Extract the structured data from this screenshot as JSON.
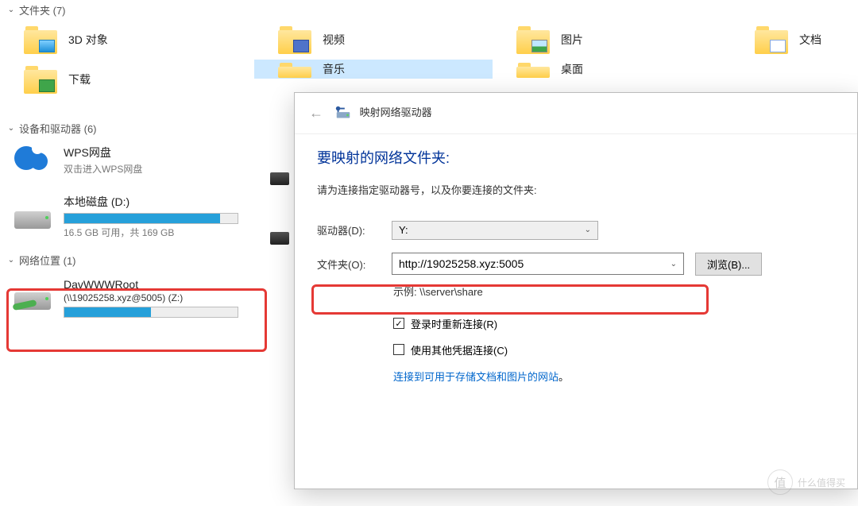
{
  "sections": {
    "folders_header": "文件夹 (7)",
    "devices_header": "设备和驱动器 (6)",
    "network_header": "网络位置 (1)"
  },
  "folders": {
    "f3d": "3D 对象",
    "videos": "视频",
    "pictures": "图片",
    "documents": "文档",
    "downloads": "下载",
    "music": "音乐",
    "desktop": "桌面"
  },
  "wps": {
    "title": "WPS网盘",
    "sub": "双击进入WPS网盘"
  },
  "local_disk": {
    "title": "本地磁盘 (D:)",
    "usage_text": "16.5 GB 可用，共 169 GB",
    "fill_pct": 90
  },
  "network_drive": {
    "title": "DavWWWRoot",
    "sub": "(\\\\19025258.xyz@5005) (Z:)",
    "fill_pct": 50
  },
  "dialog": {
    "title": "映射网络驱动器",
    "heading": "要映射的网络文件夹:",
    "desc": "请为连接指定驱动器号，以及你要连接的文件夹:",
    "drive_label": "驱动器(D):",
    "drive_value": "Y:",
    "folder_label": "文件夹(O):",
    "folder_value": "http://19025258.xyz:5005",
    "browse": "浏览(B)...",
    "example": "示例: \\\\server\\share",
    "reconnect": "登录时重新连接(R)",
    "othercred": "使用其他凭据连接(C)",
    "link_text": "连接到可用于存储文档和图片的网站",
    "link_dot": "。"
  },
  "watermark": {
    "char": "值",
    "text": "什么值得买"
  }
}
